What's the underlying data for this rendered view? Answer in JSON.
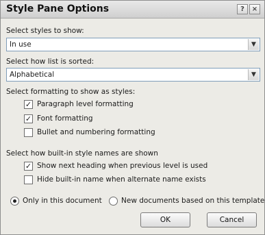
{
  "dialog": {
    "title": "Style Pane Options",
    "help_icon_glyph": "?",
    "close_icon_glyph": "×"
  },
  "styles_to_show": {
    "label": "Select styles to show:",
    "value": "In use"
  },
  "sort_order": {
    "label": "Select how list is sorted:",
    "value": "Alphabetical"
  },
  "formatting": {
    "label": "Select formatting to show as styles:",
    "options": [
      {
        "label": "Paragraph level formatting",
        "checked": true
      },
      {
        "label": "Font formatting",
        "checked": true
      },
      {
        "label": "Bullet and numbering formatting",
        "checked": false
      }
    ]
  },
  "builtin_names": {
    "label": "Select how built-in style names are shown",
    "options": [
      {
        "label": "Show next heading when previous level is used",
        "checked": true
      },
      {
        "label": "Hide built-in name when alternate name exists",
        "checked": false
      }
    ]
  },
  "scope": {
    "options": [
      {
        "label": "Only in this document",
        "selected": true
      },
      {
        "label": "New documents based on this template",
        "selected": false
      }
    ]
  },
  "buttons": {
    "ok": "OK",
    "cancel": "Cancel"
  },
  "glyphs": {
    "check": "✓",
    "dropdown": "▼"
  }
}
